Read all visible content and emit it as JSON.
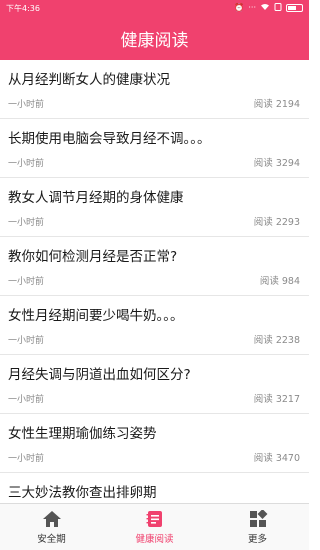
{
  "status_bar": {
    "time": "下午4:36",
    "icons": [
      "alarm-icon",
      "dots-icon",
      "wifi-icon",
      "sim-icon",
      "battery-icon"
    ]
  },
  "header": {
    "title": "健康阅读"
  },
  "articles": [
    {
      "title": "从月经判断女人的健康状况",
      "time": "一小时前",
      "reads": "阅读 2194"
    },
    {
      "title": "长期使用电脑会导致月经不调。。。",
      "time": "一小时前",
      "reads": "阅读 3294"
    },
    {
      "title": "教女人调节月经期的身体健康",
      "time": "一小时前",
      "reads": "阅读 2293"
    },
    {
      "title": "教你如何检测月经是否正常?",
      "time": "一小时前",
      "reads": "阅读 984"
    },
    {
      "title": "女性月经期间要少喝牛奶。。。",
      "time": "一小时前",
      "reads": "阅读 2238"
    },
    {
      "title": "月经失调与阴道出血如何区分?",
      "time": "一小时前",
      "reads": "阅读 3217"
    },
    {
      "title": "女性生理期瑜伽练习姿势",
      "time": "一小时前",
      "reads": "阅读 3470"
    },
    {
      "title": "三大妙法教你查出排卵期",
      "time": "",
      "reads": ""
    }
  ],
  "tabs": [
    {
      "label": "安全期",
      "icon": "home-icon",
      "active": false
    },
    {
      "label": "健康阅读",
      "icon": "book-icon",
      "active": true
    },
    {
      "label": "更多",
      "icon": "grid-icon",
      "active": false
    }
  ],
  "colors": {
    "accent": "#f0416e",
    "tab_icon": "#555555"
  }
}
